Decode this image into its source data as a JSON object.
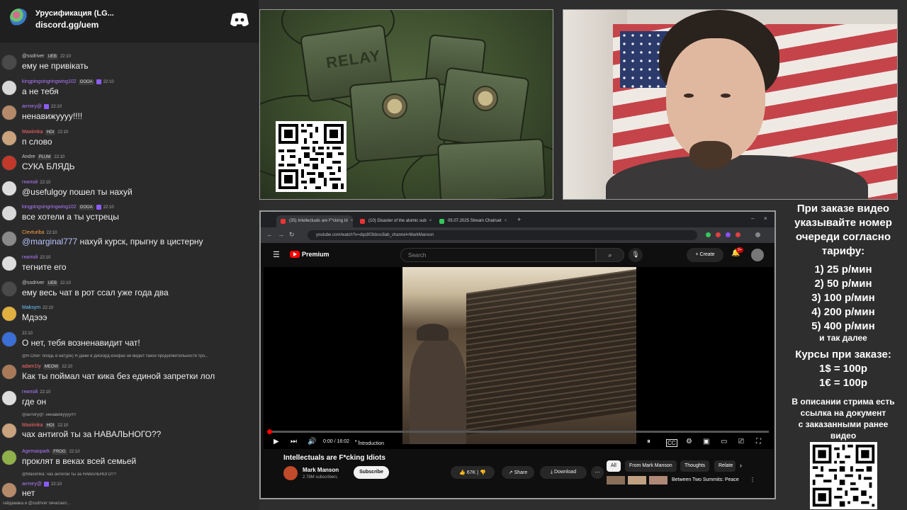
{
  "discord": {
    "server_name": "Урусификация (LG...",
    "invite": "discord.gg/uem"
  },
  "chat": {
    "messages": [
      {
        "nick": "@ssdriver",
        "badge": "UEB",
        "time": "22:10",
        "text": "ему не привікать"
      },
      {
        "nick": "kingpingsingringwing102",
        "badge": "GOOA",
        "time": "22:10",
        "text": "а не тебя"
      },
      {
        "nick": "антигу@",
        "badge": "",
        "time": "22:10",
        "text": "ненавижуууу!!!!"
      },
      {
        "nick": "Maxiimka",
        "badge": "НОІ",
        "time": "22:10",
        "text": "п слово"
      },
      {
        "nick": "Andre",
        "badge": "PLUM",
        "time": "22:10",
        "text": "СУКА БЛЯДЬ"
      },
      {
        "nick": "гнилой",
        "badge": "",
        "time": "22:10",
        "text": "@usefulgoy пошел ты нахуй"
      },
      {
        "nick": "kingpingsingringwing102",
        "badge": "GOOA",
        "time": "22:10",
        "text": "все хотели а ты устрецы"
      },
      {
        "nick": "Cievturiba",
        "badge": "",
        "time": "22:10",
        "mention": "@marginal777",
        "text": " нахуй курск, прыгну в цистерну"
      },
      {
        "nick": "гнилой",
        "badge": "",
        "time": "22:10",
        "text": "тегните его"
      },
      {
        "nick": "@ssdriver",
        "badge": "UEB",
        "time": "22:10",
        "text": "ему весь чат в рот ссал уже года два"
      },
      {
        "nick": "Maksym",
        "badge": "",
        "time": "22:10",
        "text": "Мдэээ"
      },
      {
        "nick": "",
        "badge": "",
        "time": "22:10",
        "text": "О нет, тебя возненавидит чат!"
      },
      {
        "reply": "@R.Oner: блядь в натуре) Я даже в дискорд конфах не видел такой продолжительности тро...",
        "nick": "adam1ty",
        "badge": "MEOW",
        "time": "22:10",
        "text": "Как ты поймал чат кика без единой запретки лол"
      },
      {
        "nick": "гнилой",
        "badge": "",
        "time": "22:10",
        "text": "где он"
      },
      {
        "reply": "@антигу@: ненавижуууу!!!!",
        "nick": "Maxiimka",
        "badge": "НОІ",
        "time": "22:10",
        "text": "чах антигой ты за НАВАЛЬНОГО??"
      },
      {
        "nick": "Agemaspark",
        "badge": "FROG",
        "time": "22:10",
        "text": "проклят в веках всей семьей"
      },
      {
        "reply": "@Maxiimka: чах антигой ты за НАВАЛЬНОГО??",
        "nick": "антигу@",
        "badge": "",
        "time": "22:10",
        "text": "нет"
      }
    ],
    "typing": "гайдамака и @ssdriver печатают..."
  },
  "relay_image": {
    "label": "RELAY"
  },
  "browser": {
    "tabs": [
      {
        "label": "(35) Intellectuals are F*cking Id"
      },
      {
        "label": "(10) Disaster of the atomic sub"
      },
      {
        "label": "05.07.2025 Stream Chatruet"
      }
    ],
    "url": "youtube.com/watch?v=dqs803dxsc8ab_channel=MarkManson"
  },
  "youtube": {
    "brand": "Premium",
    "search_placeholder": "Search",
    "create_label": "Create",
    "notif_count": "9+",
    "time": "0:00 / 16:02",
    "chapter": "Introduction",
    "title": "Intellectuals are F*cking Idiots",
    "channel": "Mark Manson",
    "subscribers": "2.78M subscribers",
    "subscribe_label": "Subscribe",
    "likes": "67K",
    "share_label": "Share",
    "download_label": "Download",
    "chips": [
      "All",
      "From Mark Manson",
      "Thoughts",
      "Relate"
    ],
    "rec_title": "Between Two Summits: Peace"
  },
  "panel": {
    "intro": [
      "При заказе видео",
      "указывайте номер",
      "очереди согласно",
      "тарифу:"
    ],
    "tariffs": [
      "1) 25 р/мин",
      "2) 50 р/мин",
      "3) 100 р/мин",
      "4) 200 р/мин",
      "5) 400 р/мин"
    ],
    "more": "и так далее",
    "rates_title": "Курсы при заказе:",
    "rates": [
      "1$ = 100р",
      "1€ = 100р"
    ],
    "desc": [
      "В описании стрима есть",
      "ссылка на документ",
      "с заказанными ранее",
      "видео"
    ]
  }
}
